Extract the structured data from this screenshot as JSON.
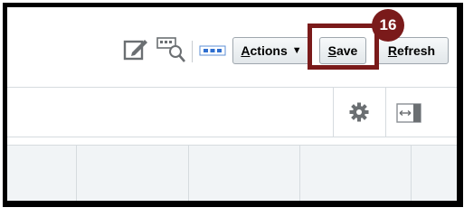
{
  "toolbar": {
    "edit_icon": "edit-icon",
    "query_icon": "query-by-example-icon",
    "more_icon": "detach-icon",
    "actions_label_prefix": "A",
    "actions_label_rest": "ctions",
    "actions_caret": "▼",
    "save_label_prefix": "S",
    "save_label_rest": "ave",
    "refresh_label_prefix": "R",
    "refresh_label_rest": "efresh"
  },
  "callout": {
    "step_number": "16",
    "color": "#7a1a1a"
  },
  "search_row": {
    "settings_icon": "gear-icon",
    "panel_icon": "expand-panel-icon"
  },
  "colors": {
    "frame": "#000000",
    "button_border": "#9fa7ae",
    "grid_header_bg": "#f1f4f6",
    "divider": "#d6dbdf"
  }
}
